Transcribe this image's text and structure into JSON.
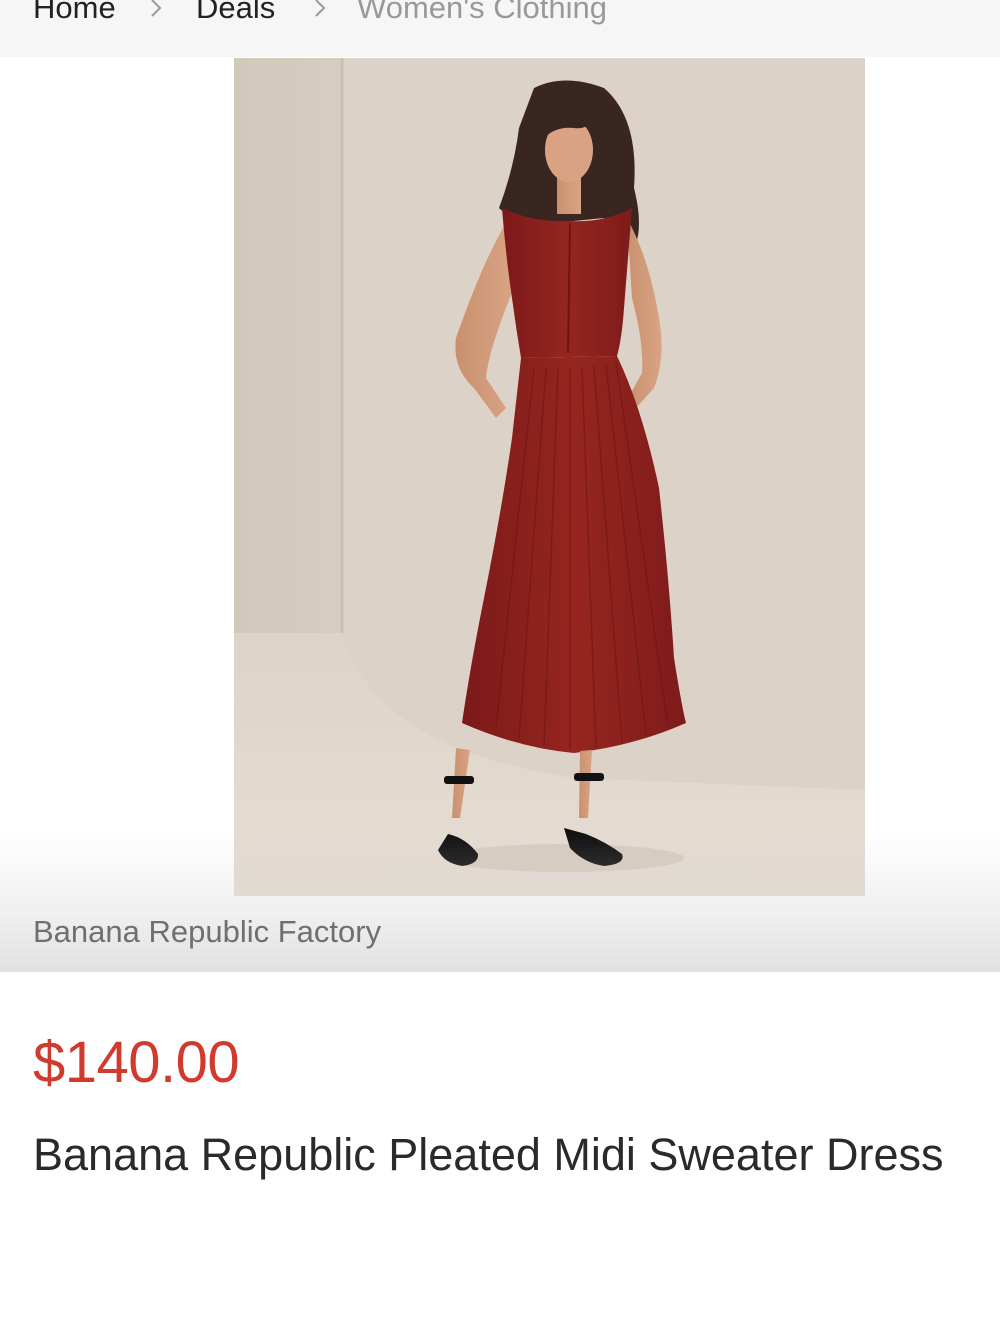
{
  "breadcrumb": {
    "items": [
      "Home",
      "Deals",
      "Women's Clothing"
    ],
    "separator_icon": "chevron-right-icon"
  },
  "product": {
    "image_alt": "Model wearing a red pleated midi sweater dress with black strappy heels",
    "brand": "Banana Republic Factory",
    "price": "$140.00",
    "title": "Banana Republic Pleated Midi Sweater Dress"
  },
  "colors": {
    "price": "#d03a2f",
    "dress": "#8e1f1f",
    "background": "#d9cfc4",
    "breadcrumb_bg": "#f6f6f6"
  }
}
